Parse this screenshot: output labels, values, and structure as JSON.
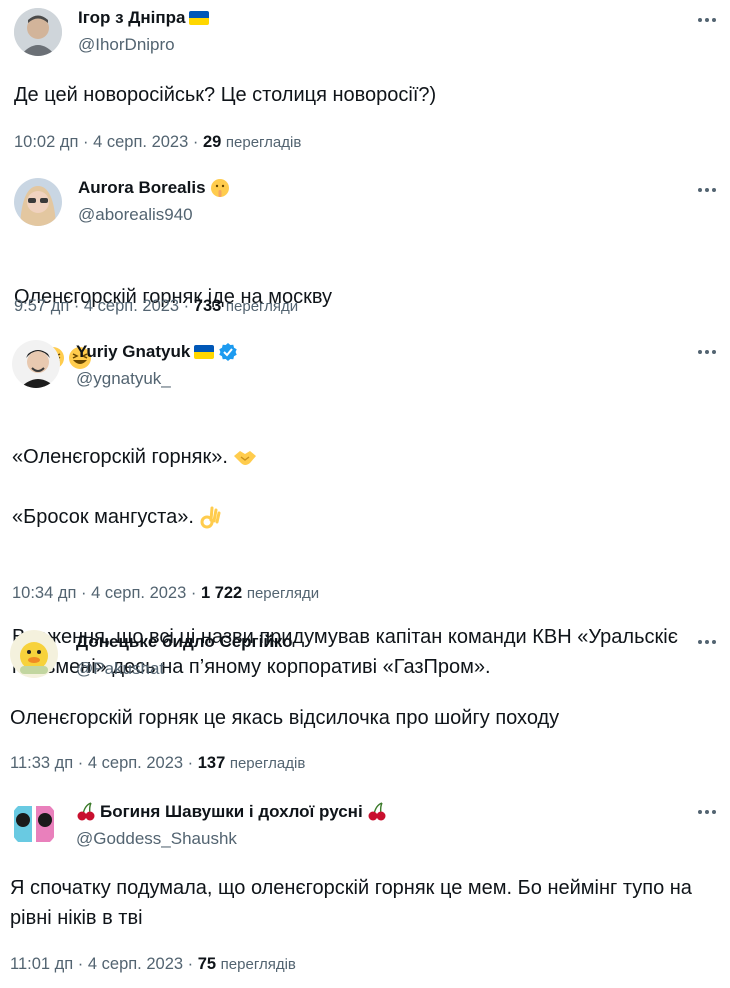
{
  "tweets": [
    {
      "name": "Ігор з Дніпра",
      "handle": "@IhorDnipro",
      "text": "Де цей новоросійськ? Це столиця новоросії?)",
      "time": "10:02 дп · 4 серп. 2023 · ",
      "views": "29",
      "views_label": "перегладів",
      "badge": "ukraine-flag-icon"
    },
    {
      "name": "Aurora Borealis",
      "handle": "@aborealis940",
      "text": "Оленєгорскій горняк іде на москву",
      "time": "9:57 дп · 4 серп. 2023 · ",
      "views": "733",
      "views_label": "перегляди",
      "badge": "shushing-face-emoji",
      "text_emoji": "grinning-squinting-face-emoji x3"
    },
    {
      "name": "Yuriy Gnatyuk",
      "handle": "@ygnatyuk_",
      "text_line1": "«Оленєгорскій горняк». ",
      "text_line2": "«Бросок мангуста». ",
      "text_line3": "Враження, що всі ці назви придумував капітан команди КВН «Уральскіє пельмені» десь на п’яному корпоративі «ГазПром».",
      "time": "10:34 дп · 4 серп. 2023 · ",
      "views": "1 722",
      "views_label": "перегляди",
      "badge": "ukraine-flag-icon + verified-badge-icon"
    },
    {
      "name": "Донецьке бидло Сергійко",
      "handle": "@Pakushat",
      "text": "Оленєгорскій горняк це якась відсилочка про шойгу походу",
      "time": "11:33 дп · 4 серп. 2023 · ",
      "views": "137",
      "views_label": "перегладів"
    },
    {
      "name": "Богиня Шавушки і дохлої руснi",
      "handle": "@Goddess_Shaushk",
      "text": "Я спочатку подумала, що оленєгорскій горняк це мем. Бо неймінг тупо на рівні ніків в тві",
      "time": "11:01 дп · 4 серп. 2023 · ",
      "views": "75",
      "views_label": "переглядів",
      "badge": "cherries-emoji"
    }
  ],
  "colors": {
    "text": "#0f1419",
    "secondary": "#536471",
    "verified": "#1d9bf0",
    "flag_blue": "#0057b7",
    "flag_yellow": "#ffd700"
  }
}
